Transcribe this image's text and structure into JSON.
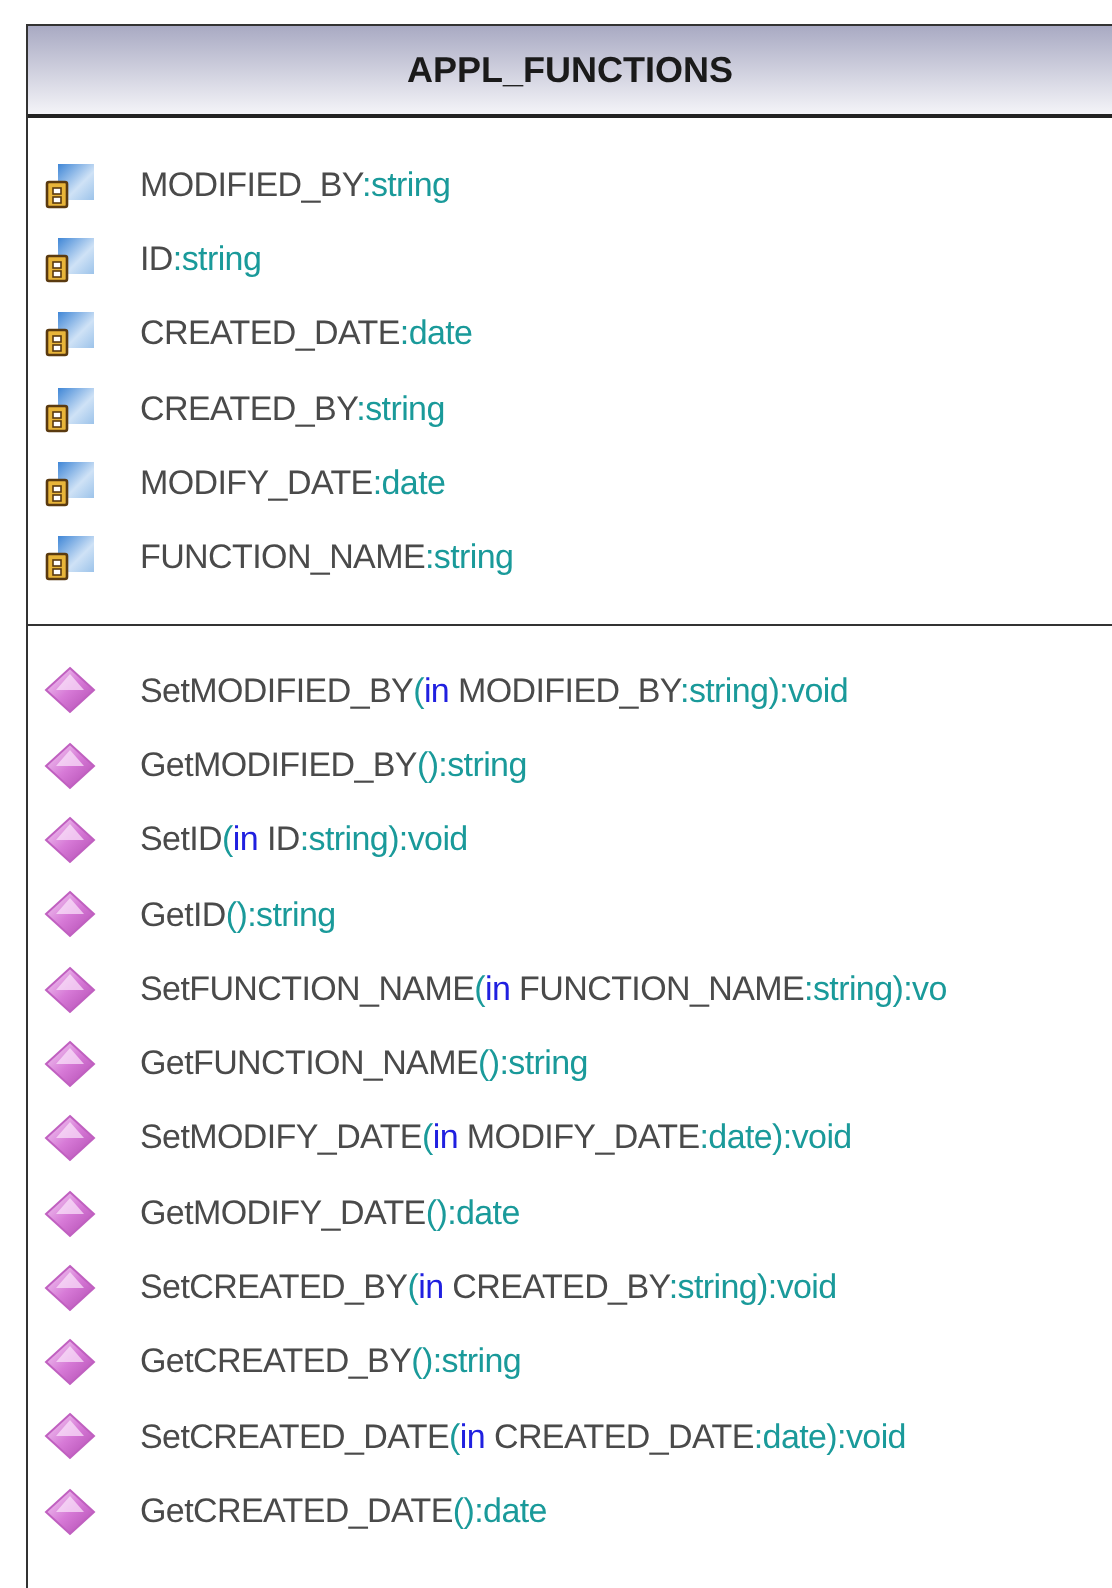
{
  "class": {
    "name": "APPL_FUNCTIONS",
    "attributes": [
      {
        "parts": [
          {
            "kind": "name",
            "text": "MODIFIED_BY"
          },
          {
            "kind": "type",
            "text": ":string"
          }
        ]
      },
      {
        "parts": [
          {
            "kind": "name",
            "text": "ID"
          },
          {
            "kind": "type",
            "text": ":string"
          }
        ]
      },
      {
        "parts": [
          {
            "kind": "name",
            "text": "CREATED_DATE"
          },
          {
            "kind": "type",
            "text": ":date"
          }
        ]
      },
      {
        "parts": [
          {
            "kind": "name",
            "text": "CREATED_BY"
          },
          {
            "kind": "type",
            "text": ":string"
          }
        ]
      },
      {
        "parts": [
          {
            "kind": "name",
            "text": "MODIFY_DATE"
          },
          {
            "kind": "type",
            "text": ":date"
          }
        ]
      },
      {
        "parts": [
          {
            "kind": "name",
            "text": "FUNCTION_NAME"
          },
          {
            "kind": "type",
            "text": ":string"
          }
        ]
      }
    ],
    "operations": [
      {
        "parts": [
          {
            "kind": "name",
            "text": "SetMODIFIED_BY"
          },
          {
            "kind": "type",
            "text": "("
          },
          {
            "kind": "keyword",
            "text": "in"
          },
          {
            "kind": "name",
            "text": " MODIFIED_BY"
          },
          {
            "kind": "type",
            "text": ":string):void"
          }
        ]
      },
      {
        "parts": [
          {
            "kind": "name",
            "text": "GetMODIFIED_BY"
          },
          {
            "kind": "type",
            "text": "():string"
          }
        ]
      },
      {
        "parts": [
          {
            "kind": "name",
            "text": "SetID"
          },
          {
            "kind": "type",
            "text": "("
          },
          {
            "kind": "keyword",
            "text": "in"
          },
          {
            "kind": "name",
            "text": " ID"
          },
          {
            "kind": "type",
            "text": ":string):void"
          }
        ]
      },
      {
        "parts": [
          {
            "kind": "name",
            "text": "GetID"
          },
          {
            "kind": "type",
            "text": "():string"
          }
        ]
      },
      {
        "parts": [
          {
            "kind": "name",
            "text": "SetFUNCTION_NAME"
          },
          {
            "kind": "type",
            "text": "("
          },
          {
            "kind": "keyword",
            "text": "in"
          },
          {
            "kind": "name",
            "text": " FUNCTION_NAME"
          },
          {
            "kind": "type",
            "text": ":string):vo"
          }
        ]
      },
      {
        "parts": [
          {
            "kind": "name",
            "text": "GetFUNCTION_NAME"
          },
          {
            "kind": "type",
            "text": "():string"
          }
        ]
      },
      {
        "parts": [
          {
            "kind": "name",
            "text": "SetMODIFY_DATE"
          },
          {
            "kind": "type",
            "text": "("
          },
          {
            "kind": "keyword",
            "text": "in"
          },
          {
            "kind": "name",
            "text": " MODIFY_DATE"
          },
          {
            "kind": "type",
            "text": ":date):void"
          }
        ]
      },
      {
        "parts": [
          {
            "kind": "name",
            "text": "GetMODIFY_DATE"
          },
          {
            "kind": "type",
            "text": "():date"
          }
        ]
      },
      {
        "parts": [
          {
            "kind": "name",
            "text": "SetCREATED_BY"
          },
          {
            "kind": "type",
            "text": "("
          },
          {
            "kind": "keyword",
            "text": "in"
          },
          {
            "kind": "name",
            "text": " CREATED_BY"
          },
          {
            "kind": "type",
            "text": ":string):void"
          }
        ]
      },
      {
        "parts": [
          {
            "kind": "name",
            "text": "GetCREATED_BY"
          },
          {
            "kind": "type",
            "text": "():string"
          }
        ]
      },
      {
        "parts": [
          {
            "kind": "name",
            "text": "SetCREATED_DATE"
          },
          {
            "kind": "type",
            "text": "("
          },
          {
            "kind": "keyword",
            "text": "in"
          },
          {
            "kind": "name",
            "text": " CREATED_DATE"
          },
          {
            "kind": "type",
            "text": ":date):void"
          }
        ]
      },
      {
        "parts": [
          {
            "kind": "name",
            "text": "GetCREATED_DATE"
          },
          {
            "kind": "type",
            "text": "():date"
          }
        ]
      }
    ]
  }
}
